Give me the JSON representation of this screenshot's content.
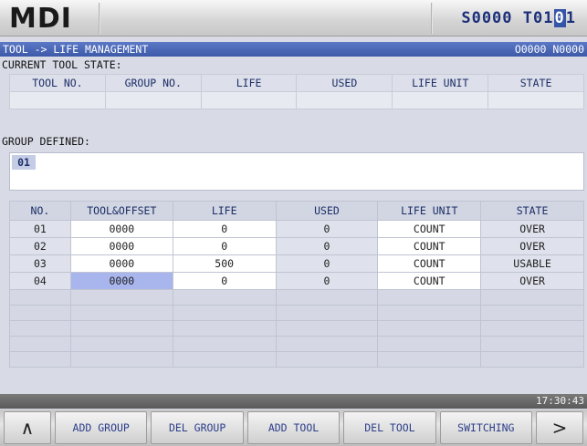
{
  "header": {
    "mode": "MDI",
    "spindle": "S0000",
    "tool_pre": "T01",
    "tool_cursor": "0",
    "tool_post": "1"
  },
  "titlebar": {
    "path": "TOOL -> LIFE MANAGEMENT",
    "program": "O0000 N0000"
  },
  "current_state": {
    "label": "CURRENT TOOL STATE:",
    "columns": [
      "TOOL NO.",
      "GROUP NO.",
      "LIFE",
      "USED",
      "LIFE UNIT",
      "STATE"
    ]
  },
  "group_defined": {
    "label": "GROUP DEFINED:",
    "groups": [
      "01"
    ]
  },
  "table": {
    "columns": [
      "NO.",
      "TOOL&OFFSET",
      "LIFE",
      "USED",
      "LIFE UNIT",
      "STATE"
    ],
    "rows": [
      [
        "01",
        "0000",
        "0",
        "0",
        "COUNT",
        "OVER"
      ],
      [
        "02",
        "0000",
        "0",
        "0",
        "COUNT",
        "OVER"
      ],
      [
        "03",
        "0000",
        "500",
        "0",
        "COUNT",
        "USABLE"
      ],
      [
        "04",
        "0000",
        "0",
        "0",
        "COUNT",
        "OVER"
      ]
    ]
  },
  "status": {
    "time": "17:30:43"
  },
  "softkeys": {
    "prev_icon": "up-chevron-icon",
    "prev_glyph": "∧",
    "k1": "ADD GROUP",
    "k2": "DEL GROUP",
    "k3": "ADD TOOL",
    "k4": "DEL TOOL",
    "k5": "SWITCHING",
    "next_icon": "next-arrow-icon",
    "next_glyph": ">"
  },
  "colors": {
    "title_bar": "#3d5aa8",
    "selection": "#a9b6ee",
    "panel": "#d8dbe6"
  }
}
